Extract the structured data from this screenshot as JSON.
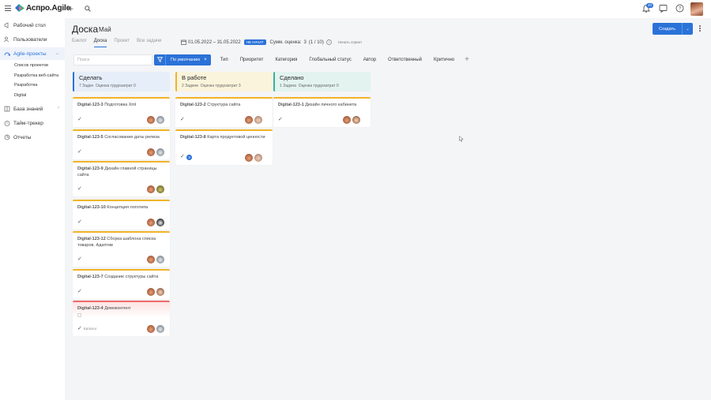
{
  "app": {
    "name": "Аспро.Agile",
    "notifications": "40"
  },
  "sidebar": {
    "items": [
      {
        "label": "Рабочий стол",
        "icon": "megaphone-icon"
      },
      {
        "label": "Пользователи",
        "icon": "users-icon"
      },
      {
        "label": "Agile-проекты",
        "icon": "agile-icon"
      },
      {
        "label": "База знаний",
        "icon": "book-icon"
      },
      {
        "label": "Тайм-трекер",
        "icon": "timer-icon"
      },
      {
        "label": "Отчеты",
        "icon": "reports-icon"
      }
    ],
    "subitems": [
      "Список проектов",
      "Разработка веб-сайта",
      "Разработка",
      "Digital"
    ]
  },
  "header": {
    "title": "Доска",
    "subtitle": "Май",
    "tabs": [
      "Бэклог",
      "Доска",
      "Проект",
      "Все задачи"
    ],
    "active_tab": "Доска",
    "dates": "01.05.2022 – 31.05.2022",
    "status": "НЕ НАЧАТ",
    "sum_label": "Сумм. оценка:",
    "sum_value": "3",
    "sum_detail": "(1 / 10)",
    "start_sprint": "Начать спринт",
    "create_label": "Создать"
  },
  "filters": {
    "search_placeholder": "Поиск",
    "default_label": "По умолчанию",
    "chips": [
      "Тип",
      "Приоритет",
      "Категория",
      "Глобальный статус",
      "Автор",
      "Ответственный",
      "Критично"
    ]
  },
  "columns": [
    {
      "title": "Сделать",
      "tasks": "7 Задач",
      "estimate": "Оценка трудозатрат 0",
      "color": "#e6eef9",
      "border": "#2b72d8"
    },
    {
      "title": "В работе",
      "tasks": "2 Задачи",
      "estimate": "Оценка трудозатрат 3",
      "color": "#fbf4dc",
      "border": "#f0b429"
    },
    {
      "title": "Сделано",
      "tasks": "1 Задача",
      "estimate": "Оценка трудозатрат 0",
      "color": "#e3f3ef",
      "border": "#38b58f"
    }
  ],
  "cards": {
    "todo": [
      {
        "key": "Digital-123-3",
        "title": "Подготовка Xml"
      },
      {
        "key": "Digital-123-5",
        "title": "Согласование даты релиза"
      },
      {
        "key": "Digital-123-9",
        "title": "Дизайн главной страницы сайта"
      },
      {
        "key": "Digital-123-10",
        "title": "Концепция логотипа"
      },
      {
        "key": "Digital-123-12",
        "title": "Сборка шаблона списка товаров. Адаптив"
      },
      {
        "key": "Digital-123-7",
        "title": "Создание структуры сайта"
      },
      {
        "key": "Digital-123-4",
        "title": "Демоконтент",
        "note": "Каталог"
      }
    ],
    "inprogress": [
      {
        "key": "Digital-123-2",
        "title": "Структура сайта"
      },
      {
        "key": "Digital-123-8",
        "title": "Карта продуктовой ценности",
        "count": "3"
      }
    ],
    "done": [
      {
        "key": "Digital-123-1",
        "title": "Дизайн личного кабинета"
      }
    ]
  }
}
